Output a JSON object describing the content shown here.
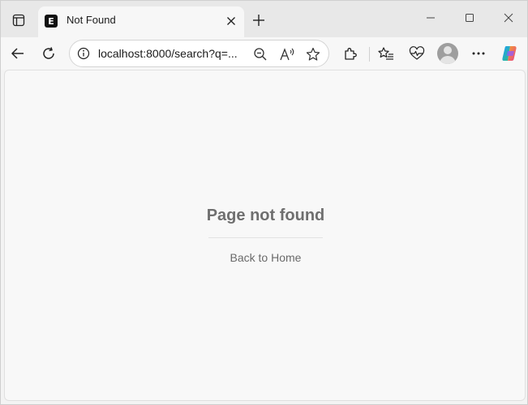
{
  "browser": {
    "tab": {
      "favicon_letter": "E",
      "title": "Not Found"
    },
    "address_bar": {
      "url": "localhost:8000/search?q=..."
    },
    "icons": {
      "tab_actions": "tab-actions-icon",
      "close_tab": "close-icon",
      "new_tab": "plus-icon",
      "minimize": "minimize-icon",
      "maximize": "maximize-icon",
      "close_window": "close-icon",
      "back": "back-arrow-icon",
      "refresh": "refresh-icon",
      "site_info": "info-icon",
      "zoom": "zoom-out-icon",
      "read_aloud": "read-aloud-icon",
      "favorite": "star-icon",
      "extensions": "puzzle-icon",
      "favorites": "favorites-icon",
      "performance": "heart-pulse-icon",
      "profile": "avatar",
      "more": "more-icon",
      "copilot": "copilot-icon"
    },
    "colors": {
      "tabstrip": "#e8e8e8",
      "toolbar": "#f7f7f7",
      "page_bg": "#f8f8f8"
    }
  },
  "page": {
    "title": "Page not found",
    "link": "Back to Home"
  }
}
